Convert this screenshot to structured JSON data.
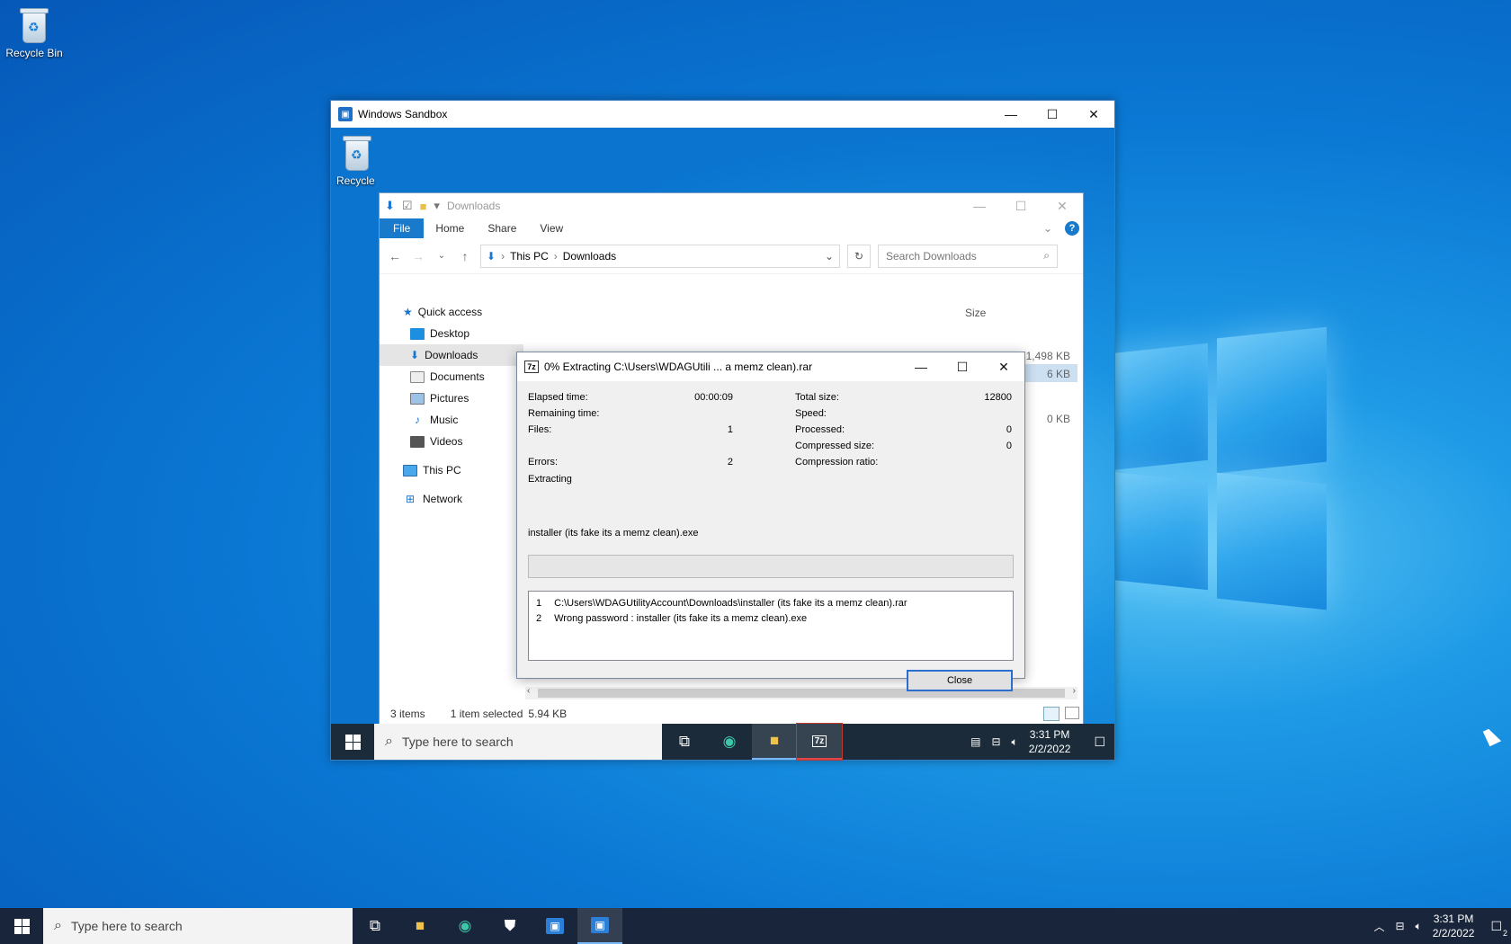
{
  "desktop": {
    "recycle_bin_label": "Recycle Bin"
  },
  "sandbox_window": {
    "title": "Windows Sandbox",
    "inner_recycle_label": "Recycle"
  },
  "explorer": {
    "title": "Downloads",
    "ribbon_tabs": [
      "File",
      "Home",
      "Share",
      "View"
    ],
    "breadcrumb": [
      "This PC",
      "Downloads"
    ],
    "search_placeholder": "Search Downloads",
    "nav_items": [
      "Quick access",
      "Desktop",
      "Downloads",
      "Documents",
      "Pictures",
      "Music",
      "Videos",
      "This PC",
      "Network"
    ],
    "column_size": "Size",
    "file_sizes": [
      "1,498 KB",
      "6 KB",
      "0 KB"
    ],
    "status_items": "3 items",
    "status_selected": "1 item selected",
    "status_size": "5.94 KB"
  },
  "dialog": {
    "title": "0% Extracting C:\\Users\\WDAGUtili ... a memz clean).rar",
    "elapsed_label": "Elapsed time:",
    "elapsed_value": "00:00:09",
    "remaining_label": "Remaining time:",
    "files_label": "Files:",
    "files_value": "1",
    "errors_label": "Errors:",
    "errors_value": "2",
    "total_size_label": "Total size:",
    "total_size_value": "12800",
    "speed_label": "Speed:",
    "processed_label": "Processed:",
    "processed_value": "0",
    "compressed_label": "Compressed size:",
    "compressed_value": "0",
    "ratio_label": "Compression ratio:",
    "status": "Extracting",
    "current_file": "installer (its fake its a memz clean).exe",
    "progress_percent": 0,
    "log": [
      {
        "num": "1",
        "text": "C:\\Users\\WDAGUtilityAccount\\Downloads\\installer (its fake its a memz clean).rar"
      },
      {
        "num": "2",
        "text": "Wrong password : installer (its fake its a memz clean).exe"
      }
    ],
    "close_label": "Close"
  },
  "inner_taskbar": {
    "search_placeholder": "Type here to search",
    "time": "3:31 PM",
    "date": "2/2/2022"
  },
  "taskbar": {
    "search_placeholder": "Type here to search",
    "time": "3:31 PM",
    "date": "2/2/2022",
    "notification_count": "2"
  }
}
